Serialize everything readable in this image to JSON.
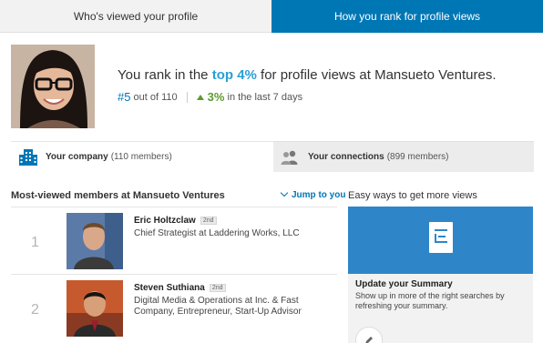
{
  "tabs": {
    "viewed": "Who's viewed your profile",
    "rank": "How you rank for profile views"
  },
  "rank": {
    "prefix": "You rank in the",
    "highlight": "top 4%",
    "suffix": "for profile views at Mansueto Ventures.",
    "position": "#5",
    "out_of": "out of 110",
    "change": "3%",
    "period": "in the last 7 days"
  },
  "segments": {
    "company_label": "Your company",
    "company_count": "(110 members)",
    "connections_label": "Your connections",
    "connections_count": "(899 members)"
  },
  "most_viewed": {
    "title": "Most-viewed members at Mansueto Ventures",
    "jump": "Jump to you",
    "members": [
      {
        "rank": "1",
        "name": "Eric Holtzclaw",
        "degree": "2nd",
        "title": "Chief Strategist at Laddering Works, LLC"
      },
      {
        "rank": "2",
        "name": "Steven Suthiana",
        "degree": "2nd",
        "title": "Digital Media & Operations at Inc. & Fast Company, Entrepreneur, Start-Up Advisor"
      }
    ]
  },
  "ways": {
    "title": "Easy ways to get more views",
    "card_heading": "Update your Summary",
    "card_desc": "Show up in more of the right searches by refreshing your summary."
  },
  "colors": {
    "brand": "#0077b5",
    "highlight": "#2a9fd6",
    "up": "#5b9a2f"
  }
}
